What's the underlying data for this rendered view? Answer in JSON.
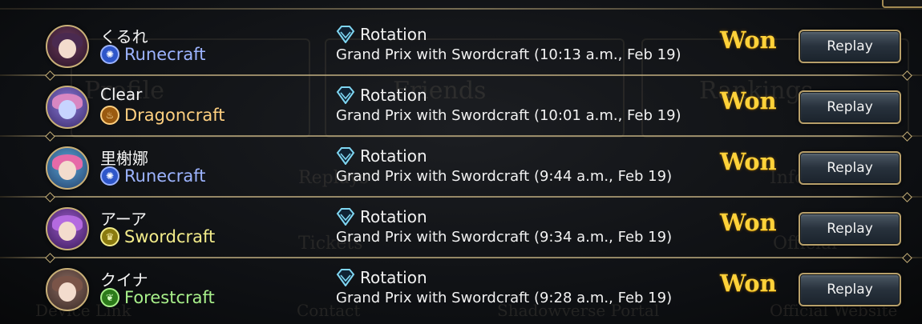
{
  "background_ghost": {
    "profile": "Profile",
    "friends": "Friends",
    "rankings": "Rankings",
    "replays": "Replays",
    "info": "Info",
    "tickets": "Tickets",
    "official": "Official",
    "contact": "Contact",
    "portal": "Shadowverse Portal",
    "website": "Official Website",
    "device_link": "Device Link"
  },
  "colors": {
    "gold": "#ffd23a",
    "runecraft": "#9db4ff",
    "dragoncraft": "#ffd080",
    "swordcraft": "#f3ec8a",
    "forestcraft": "#a8f08a"
  },
  "matches": [
    {
      "player": "くるれ",
      "class": "Runecraft",
      "class_icon": "runecraft-icon",
      "format": "Rotation",
      "format_icon": "rotation-diamond-icon",
      "description": "Grand Prix with Swordcraft (10:13 a.m., Feb 19)",
      "result": "Won",
      "replay_label": "Replay"
    },
    {
      "player": "Clear",
      "class": "Dragoncraft",
      "class_icon": "dragoncraft-icon",
      "format": "Rotation",
      "format_icon": "rotation-diamond-icon",
      "description": "Grand Prix with Swordcraft (10:01 a.m., Feb 19)",
      "result": "Won",
      "replay_label": "Replay"
    },
    {
      "player": "里榭娜",
      "class": "Runecraft",
      "class_icon": "runecraft-icon",
      "format": "Rotation",
      "format_icon": "rotation-diamond-icon",
      "description": "Grand Prix with Swordcraft (9:44 a.m., Feb 19)",
      "result": "Won",
      "replay_label": "Replay"
    },
    {
      "player": "アーア",
      "class": "Swordcraft",
      "class_icon": "swordcraft-icon",
      "format": "Rotation",
      "format_icon": "rotation-diamond-icon",
      "description": "Grand Prix with Swordcraft (9:34 a.m., Feb 19)",
      "result": "Won",
      "replay_label": "Replay"
    },
    {
      "player": "クイナ",
      "class": "Forestcraft",
      "class_icon": "forestcraft-icon",
      "format": "Rotation",
      "format_icon": "rotation-diamond-icon",
      "description": "Grand Prix with Swordcraft (9:28 a.m., Feb 19)",
      "result": "Won",
      "replay_label": "Replay"
    }
  ]
}
